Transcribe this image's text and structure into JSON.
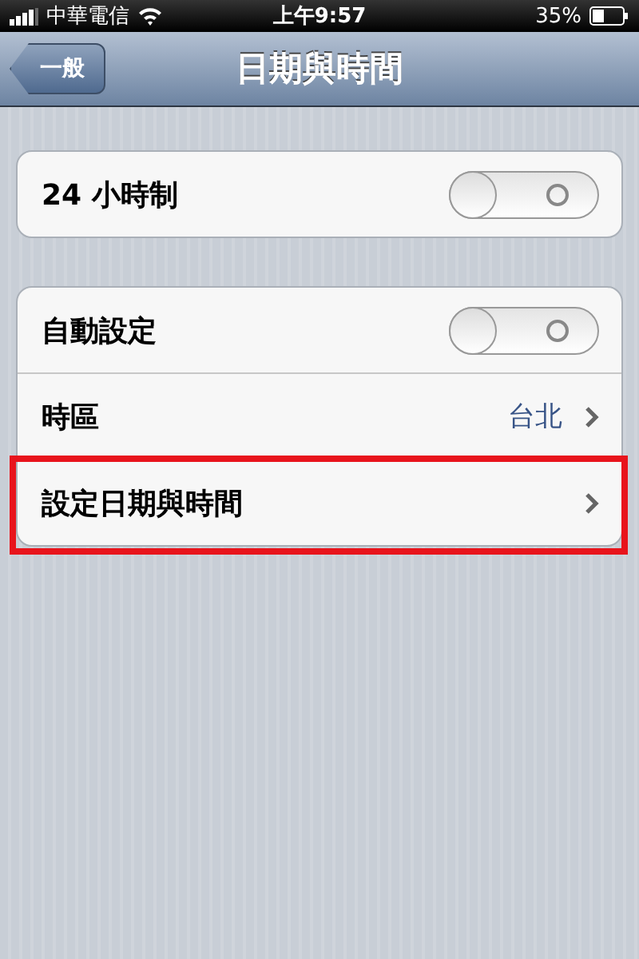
{
  "status_bar": {
    "carrier": "中華電信",
    "time": "上午9:57",
    "battery": "35%"
  },
  "nav": {
    "back": "一般",
    "title": "日期與時間"
  },
  "groups": [
    {
      "rows": [
        {
          "kind": "toggle",
          "label": "24 小時制",
          "on": false
        }
      ]
    },
    {
      "rows": [
        {
          "kind": "toggle",
          "label": "自動設定",
          "on": false
        },
        {
          "kind": "link",
          "label": "時區",
          "value": "台北",
          "highlighted": false
        },
        {
          "kind": "link",
          "label": "設定日期與時間",
          "highlighted": true
        }
      ]
    }
  ]
}
